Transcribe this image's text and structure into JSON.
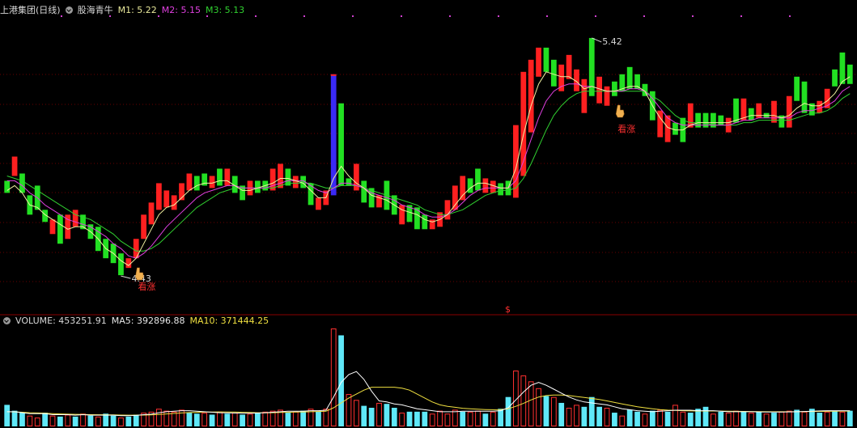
{
  "header": {
    "stock_name": "上港集团(日线)",
    "indicator_name": "股海青牛",
    "m1_label": "M1: 5.22",
    "m2_label": "M2: 5.15",
    "m3_label": "M3: 5.13"
  },
  "volume_header": {
    "label": "VOLUME: 453251.91",
    "ma5_label": "MA5: 392896.88",
    "ma10_label": "MA10: 371444.25"
  },
  "colors": {
    "up": "#ff2020",
    "down": "#22e022",
    "special": "#3a2af5",
    "m1": "#f0f0a0",
    "m2": "#e040e0",
    "m3": "#30d030",
    "vol_up": "#ff3030",
    "vol_down": "#5fe8f8",
    "ma5": "#ffffff",
    "ma10": "#f0e040",
    "grid": "#6a0000"
  },
  "chart_data": {
    "type": "bar",
    "price_range": [
      4.3,
      5.52
    ],
    "volume_max": 1000000,
    "annotations": {
      "low_value": "4.43",
      "high_value": "5.42",
      "buy_signal_text": "看涨",
      "marker_text": "$"
    },
    "price_bars": [
      [
        4.84,
        4.79,
        "d"
      ],
      [
        4.94,
        4.86,
        "u"
      ],
      [
        4.87,
        4.79,
        "d"
      ],
      [
        4.78,
        4.7,
        "d"
      ],
      [
        4.82,
        4.72,
        "d"
      ],
      [
        4.72,
        4.67,
        "d"
      ],
      [
        4.68,
        4.62,
        "u"
      ],
      [
        4.7,
        4.58,
        "d"
      ],
      [
        4.7,
        4.6,
        "u"
      ],
      [
        4.72,
        4.65,
        "u"
      ],
      [
        4.7,
        4.64,
        "d"
      ],
      [
        4.66,
        4.6,
        "d"
      ],
      [
        4.65,
        4.55,
        "d"
      ],
      [
        4.6,
        4.52,
        "d"
      ],
      [
        4.58,
        4.5,
        "d"
      ],
      [
        4.54,
        4.45,
        "d"
      ],
      [
        4.52,
        4.48,
        "u"
      ],
      [
        4.6,
        4.52,
        "u"
      ],
      [
        4.7,
        4.6,
        "u"
      ],
      [
        4.75,
        4.66,
        "u"
      ],
      [
        4.83,
        4.72,
        "u"
      ],
      [
        4.8,
        4.73,
        "u"
      ],
      [
        4.78,
        4.72,
        "u"
      ],
      [
        4.83,
        4.76,
        "u"
      ],
      [
        4.87,
        4.8,
        "u"
      ],
      [
        4.86,
        4.8,
        "d"
      ],
      [
        4.87,
        4.82,
        "d"
      ],
      [
        4.86,
        4.81,
        "u"
      ],
      [
        4.89,
        4.82,
        "d"
      ],
      [
        4.89,
        4.82,
        "u"
      ],
      [
        4.86,
        4.79,
        "d"
      ],
      [
        4.82,
        4.76,
        "d"
      ],
      [
        4.84,
        4.78,
        "u"
      ],
      [
        4.84,
        4.79,
        "d"
      ],
      [
        4.84,
        4.8,
        "d"
      ],
      [
        4.89,
        4.8,
        "u"
      ],
      [
        4.91,
        4.81,
        "u"
      ],
      [
        4.89,
        4.82,
        "d"
      ],
      [
        4.86,
        4.81,
        "u"
      ],
      [
        4.86,
        4.81,
        "d"
      ],
      [
        4.83,
        4.74,
        "d"
      ],
      [
        4.77,
        4.72,
        "u"
      ],
      [
        4.8,
        4.74,
        "u"
      ],
      [
        5.28,
        4.78,
        "s"
      ],
      [
        5.16,
        4.82,
        "d"
      ],
      [
        4.85,
        4.82,
        "d"
      ],
      [
        4.91,
        4.8,
        "u"
      ],
      [
        4.84,
        4.75,
        "d"
      ],
      [
        4.81,
        4.73,
        "d"
      ],
      [
        4.78,
        4.73,
        "u"
      ],
      [
        4.84,
        4.72,
        "d"
      ],
      [
        4.78,
        4.7,
        "d"
      ],
      [
        4.74,
        4.66,
        "u"
      ],
      [
        4.74,
        4.67,
        "d"
      ],
      [
        4.73,
        4.64,
        "d"
      ],
      [
        4.7,
        4.64,
        "d"
      ],
      [
        4.68,
        4.64,
        "u"
      ],
      [
        4.71,
        4.65,
        "u"
      ],
      [
        4.76,
        4.68,
        "u"
      ],
      [
        4.82,
        4.72,
        "u"
      ],
      [
        4.86,
        4.76,
        "u"
      ],
      [
        4.85,
        4.79,
        "d"
      ],
      [
        4.89,
        4.8,
        "d"
      ],
      [
        4.85,
        4.79,
        "u"
      ],
      [
        4.84,
        4.79,
        "u"
      ],
      [
        4.83,
        4.78,
        "d"
      ],
      [
        4.84,
        4.78,
        "d"
      ],
      [
        5.07,
        4.77,
        "u"
      ],
      [
        5.29,
        4.86,
        "u"
      ],
      [
        5.34,
        5.04,
        "u"
      ],
      [
        5.39,
        5.27,
        "u"
      ],
      [
        5.39,
        5.29,
        "d"
      ],
      [
        5.34,
        5.23,
        "d"
      ],
      [
        5.32,
        5.21,
        "u"
      ],
      [
        5.36,
        5.26,
        "u"
      ],
      [
        5.3,
        5.21,
        "u"
      ],
      [
        5.26,
        5.12,
        "u"
      ],
      [
        5.43,
        5.19,
        "d"
      ],
      [
        5.27,
        5.16,
        "u"
      ],
      [
        5.23,
        5.15,
        "u"
      ],
      [
        5.25,
        5.19,
        "d"
      ],
      [
        5.28,
        5.21,
        "d"
      ],
      [
        5.31,
        5.22,
        "d"
      ],
      [
        5.28,
        5.22,
        "d"
      ],
      [
        5.24,
        5.19,
        "d"
      ],
      [
        5.21,
        5.09,
        "d"
      ],
      [
        5.13,
        5.02,
        "u"
      ],
      [
        5.11,
        5.0,
        "u"
      ],
      [
        5.08,
        5.03,
        "d"
      ],
      [
        5.1,
        5.0,
        "d"
      ],
      [
        5.16,
        5.06,
        "u"
      ],
      [
        5.12,
        5.06,
        "d"
      ],
      [
        5.12,
        5.06,
        "d"
      ],
      [
        5.12,
        5.06,
        "d"
      ],
      [
        5.11,
        5.07,
        "d"
      ],
      [
        5.1,
        5.04,
        "u"
      ],
      [
        5.18,
        5.08,
        "d"
      ],
      [
        5.18,
        5.09,
        "u"
      ],
      [
        5.14,
        5.09,
        "d"
      ],
      [
        5.16,
        5.1,
        "u"
      ],
      [
        5.12,
        5.1,
        "d"
      ],
      [
        5.17,
        5.08,
        "u"
      ],
      [
        5.11,
        5.06,
        "d"
      ],
      [
        5.19,
        5.06,
        "u"
      ],
      [
        5.27,
        5.17,
        "d"
      ],
      [
        5.25,
        5.12,
        "d"
      ],
      [
        5.16,
        5.11,
        "d"
      ],
      [
        5.17,
        5.12,
        "u"
      ],
      [
        5.22,
        5.14,
        "u"
      ],
      [
        5.3,
        5.23,
        "d"
      ],
      [
        5.37,
        5.24,
        "d"
      ],
      [
        5.32,
        5.24,
        "d"
      ]
    ],
    "m1": [
      4.8,
      4.82,
      4.79,
      4.74,
      4.73,
      4.7,
      4.68,
      4.66,
      4.64,
      4.65,
      4.65,
      4.63,
      4.6,
      4.56,
      4.54,
      4.51,
      4.49,
      4.52,
      4.58,
      4.64,
      4.7,
      4.73,
      4.74,
      4.77,
      4.8,
      4.82,
      4.83,
      4.83,
      4.84,
      4.84,
      4.82,
      4.8,
      4.8,
      4.81,
      4.82,
      4.83,
      4.85,
      4.85,
      4.84,
      4.83,
      4.8,
      4.77,
      4.77,
      4.85,
      4.9,
      4.86,
      4.83,
      4.81,
      4.78,
      4.77,
      4.76,
      4.74,
      4.72,
      4.71,
      4.7,
      4.68,
      4.67,
      4.68,
      4.7,
      4.74,
      4.78,
      4.81,
      4.83,
      4.83,
      4.82,
      4.81,
      4.81,
      4.89,
      5.03,
      5.15,
      5.24,
      5.29,
      5.28,
      5.27,
      5.27,
      5.25,
      5.22,
      5.23,
      5.22,
      5.21,
      5.21,
      5.22,
      5.23,
      5.23,
      5.21,
      5.15,
      5.1,
      5.06,
      5.05,
      5.05,
      5.07,
      5.08,
      5.08,
      5.08,
      5.08,
      5.08,
      5.09,
      5.1,
      5.11,
      5.11,
      5.11,
      5.11,
      5.1,
      5.11,
      5.14,
      5.16,
      5.15,
      5.15,
      5.17,
      5.2,
      5.25,
      5.27
    ],
    "m2": [
      4.84,
      4.84,
      4.82,
      4.79,
      4.77,
      4.74,
      4.72,
      4.7,
      4.68,
      4.67,
      4.66,
      4.65,
      4.63,
      4.61,
      4.58,
      4.56,
      4.53,
      4.52,
      4.54,
      4.57,
      4.61,
      4.65,
      4.68,
      4.71,
      4.74,
      4.77,
      4.79,
      4.8,
      4.81,
      4.82,
      4.82,
      4.81,
      4.81,
      4.81,
      4.81,
      4.82,
      4.83,
      4.84,
      4.84,
      4.84,
      4.82,
      4.8,
      4.79,
      4.81,
      4.83,
      4.83,
      4.82,
      4.81,
      4.79,
      4.78,
      4.77,
      4.76,
      4.74,
      4.73,
      4.72,
      4.7,
      4.69,
      4.69,
      4.7,
      4.72,
      4.75,
      4.78,
      4.8,
      4.81,
      4.81,
      4.81,
      4.81,
      4.84,
      4.92,
      5.01,
      5.1,
      5.17,
      5.21,
      5.23,
      5.24,
      5.24,
      5.23,
      5.23,
      5.22,
      5.21,
      5.21,
      5.21,
      5.22,
      5.22,
      5.21,
      5.18,
      5.14,
      5.1,
      5.08,
      5.07,
      5.07,
      5.07,
      5.07,
      5.07,
      5.07,
      5.07,
      5.08,
      5.09,
      5.09,
      5.1,
      5.1,
      5.1,
      5.1,
      5.1,
      5.12,
      5.13,
      5.13,
      5.14,
      5.15,
      5.17,
      5.21,
      5.23
    ],
    "m3": [
      4.86,
      4.85,
      4.84,
      4.82,
      4.8,
      4.78,
      4.76,
      4.74,
      4.72,
      4.7,
      4.69,
      4.68,
      4.66,
      4.64,
      4.62,
      4.59,
      4.57,
      4.55,
      4.55,
      4.56,
      4.58,
      4.61,
      4.64,
      4.67,
      4.7,
      4.73,
      4.75,
      4.77,
      4.79,
      4.8,
      4.81,
      4.81,
      4.81,
      4.81,
      4.81,
      4.81,
      4.82,
      4.83,
      4.83,
      4.83,
      4.83,
      4.82,
      4.81,
      4.81,
      4.82,
      4.82,
      4.82,
      4.81,
      4.8,
      4.79,
      4.78,
      4.77,
      4.76,
      4.75,
      4.74,
      4.72,
      4.71,
      4.7,
      4.7,
      4.71,
      4.72,
      4.74,
      4.76,
      4.78,
      4.79,
      4.8,
      4.8,
      4.81,
      4.85,
      4.91,
      4.98,
      5.05,
      5.11,
      5.15,
      5.18,
      5.2,
      5.21,
      5.21,
      5.21,
      5.21,
      5.21,
      5.21,
      5.21,
      5.21,
      5.21,
      5.19,
      5.17,
      5.14,
      5.11,
      5.09,
      5.08,
      5.08,
      5.08,
      5.07,
      5.07,
      5.07,
      5.07,
      5.08,
      5.08,
      5.09,
      5.09,
      5.09,
      5.09,
      5.09,
      5.1,
      5.11,
      5.12,
      5.12,
      5.13,
      5.15,
      5.18,
      5.2
    ],
    "volume": [
      [
        220000,
        "d"
      ],
      [
        160000,
        "d"
      ],
      [
        140000,
        "d"
      ],
      [
        110000,
        "u"
      ],
      [
        90000,
        "u"
      ],
      [
        140000,
        "d"
      ],
      [
        110000,
        "u"
      ],
      [
        100000,
        "d"
      ],
      [
        120000,
        "u"
      ],
      [
        100000,
        "d"
      ],
      [
        130000,
        "u"
      ],
      [
        110000,
        "d"
      ],
      [
        100000,
        "u"
      ],
      [
        130000,
        "d"
      ],
      [
        110000,
        "d"
      ],
      [
        90000,
        "u"
      ],
      [
        100000,
        "d"
      ],
      [
        120000,
        "d"
      ],
      [
        140000,
        "u"
      ],
      [
        150000,
        "u"
      ],
      [
        180000,
        "u"
      ],
      [
        160000,
        "u"
      ],
      [
        150000,
        "u"
      ],
      [
        170000,
        "u"
      ],
      [
        140000,
        "d"
      ],
      [
        130000,
        "d"
      ],
      [
        140000,
        "u"
      ],
      [
        120000,
        "d"
      ],
      [
        150000,
        "u"
      ],
      [
        130000,
        "d"
      ],
      [
        140000,
        "u"
      ],
      [
        120000,
        "d"
      ],
      [
        130000,
        "u"
      ],
      [
        140000,
        "d"
      ],
      [
        150000,
        "u"
      ],
      [
        160000,
        "u"
      ],
      [
        170000,
        "u"
      ],
      [
        140000,
        "d"
      ],
      [
        150000,
        "u"
      ],
      [
        160000,
        "d"
      ],
      [
        180000,
        "u"
      ],
      [
        150000,
        "d"
      ],
      [
        180000,
        "u"
      ],
      [
        1000000,
        "u"
      ],
      [
        930000,
        "d"
      ],
      [
        330000,
        "u"
      ],
      [
        270000,
        "u"
      ],
      [
        210000,
        "d"
      ],
      [
        190000,
        "d"
      ],
      [
        240000,
        "u"
      ],
      [
        230000,
        "d"
      ],
      [
        190000,
        "d"
      ],
      [
        140000,
        "u"
      ],
      [
        150000,
        "d"
      ],
      [
        150000,
        "d"
      ],
      [
        150000,
        "d"
      ],
      [
        130000,
        "u"
      ],
      [
        160000,
        "u"
      ],
      [
        130000,
        "u"
      ],
      [
        170000,
        "u"
      ],
      [
        150000,
        "d"
      ],
      [
        150000,
        "u"
      ],
      [
        160000,
        "u"
      ],
      [
        130000,
        "d"
      ],
      [
        150000,
        "u"
      ],
      [
        180000,
        "d"
      ],
      [
        300000,
        "d"
      ],
      [
        570000,
        "u"
      ],
      [
        520000,
        "u"
      ],
      [
        460000,
        "u"
      ],
      [
        390000,
        "u"
      ],
      [
        310000,
        "d"
      ],
      [
        300000,
        "u"
      ],
      [
        240000,
        "d"
      ],
      [
        190000,
        "u"
      ],
      [
        220000,
        "u"
      ],
      [
        200000,
        "d"
      ],
      [
        300000,
        "d"
      ],
      [
        200000,
        "d"
      ],
      [
        190000,
        "u"
      ],
      [
        140000,
        "d"
      ],
      [
        110000,
        "u"
      ],
      [
        170000,
        "d"
      ],
      [
        150000,
        "d"
      ],
      [
        130000,
        "u"
      ],
      [
        160000,
        "d"
      ],
      [
        170000,
        "u"
      ],
      [
        150000,
        "d"
      ],
      [
        220000,
        "u"
      ],
      [
        150000,
        "u"
      ],
      [
        140000,
        "d"
      ],
      [
        180000,
        "d"
      ],
      [
        200000,
        "d"
      ],
      [
        130000,
        "u"
      ],
      [
        150000,
        "d"
      ],
      [
        140000,
        "u"
      ],
      [
        160000,
        "u"
      ],
      [
        150000,
        "d"
      ],
      [
        140000,
        "u"
      ],
      [
        150000,
        "d"
      ],
      [
        130000,
        "u"
      ],
      [
        140000,
        "d"
      ],
      [
        150000,
        "u"
      ],
      [
        160000,
        "u"
      ],
      [
        170000,
        "d"
      ],
      [
        150000,
        "u"
      ],
      [
        180000,
        "d"
      ],
      [
        140000,
        "d"
      ],
      [
        150000,
        "u"
      ],
      [
        160000,
        "d"
      ],
      [
        150000,
        "u"
      ],
      [
        160000,
        "d"
      ]
    ],
    "ma5": [
      150000,
      150000,
      140000,
      130000,
      130000,
      130000,
      120000,
      120000,
      120000,
      115000,
      120000,
      115000,
      115000,
      115000,
      115000,
      110000,
      110000,
      112000,
      120000,
      125000,
      140000,
      150000,
      155000,
      160000,
      160000,
      155000,
      150000,
      145000,
      140000,
      138000,
      136000,
      134000,
      134000,
      136000,
      140000,
      145000,
      150000,
      155000,
      155000,
      155000,
      160000,
      160000,
      165000,
      300000,
      450000,
      530000,
      560000,
      480000,
      360000,
      260000,
      250000,
      230000,
      220000,
      200000,
      180000,
      170000,
      160000,
      150000,
      150000,
      150000,
      155000,
      155000,
      155000,
      155000,
      155000,
      160000,
      190000,
      270000,
      350000,
      420000,
      450000,
      420000,
      380000,
      340000,
      300000,
      270000,
      250000,
      240000,
      230000,
      220000,
      200000,
      180000,
      170000,
      160000,
      155000,
      150000,
      155000,
      160000,
      165000,
      165000,
      165000,
      160000,
      160000,
      160000,
      155000,
      150000,
      150000,
      150000,
      150000,
      148000,
      146000,
      146000,
      146000,
      148000,
      150000,
      152000,
      155000,
      158000,
      160000,
      160000,
      160000,
      160000
    ],
    "ma10": [
      150000,
      148000,
      145000,
      140000,
      137000,
      134000,
      130000,
      127000,
      125000,
      123000,
      122000,
      120000,
      119000,
      118000,
      117000,
      116000,
      115000,
      115000,
      116000,
      118000,
      122000,
      127000,
      132000,
      137000,
      141000,
      144000,
      146000,
      147000,
      148000,
      147000,
      146000,
      144000,
      142000,
      140000,
      139000,
      140000,
      142000,
      144000,
      146000,
      148000,
      150000,
      152000,
      155000,
      190000,
      240000,
      290000,
      330000,
      370000,
      400000,
      400000,
      400000,
      400000,
      390000,
      370000,
      330000,
      290000,
      250000,
      220000,
      205000,
      195000,
      185000,
      180000,
      175000,
      172000,
      170000,
      172000,
      180000,
      205000,
      235000,
      270000,
      300000,
      315000,
      320000,
      320000,
      315000,
      305000,
      295000,
      285000,
      275000,
      260000,
      245000,
      230000,
      215000,
      200000,
      190000,
      180000,
      172000,
      166000,
      163000,
      160000,
      158000,
      157000,
      157000,
      157000,
      156000,
      155000,
      154000,
      153000,
      152000,
      151000,
      150000,
      150000,
      150000,
      150000,
      150000,
      151000,
      152000,
      153000,
      154000,
      155000,
      156000,
      156000
    ]
  }
}
